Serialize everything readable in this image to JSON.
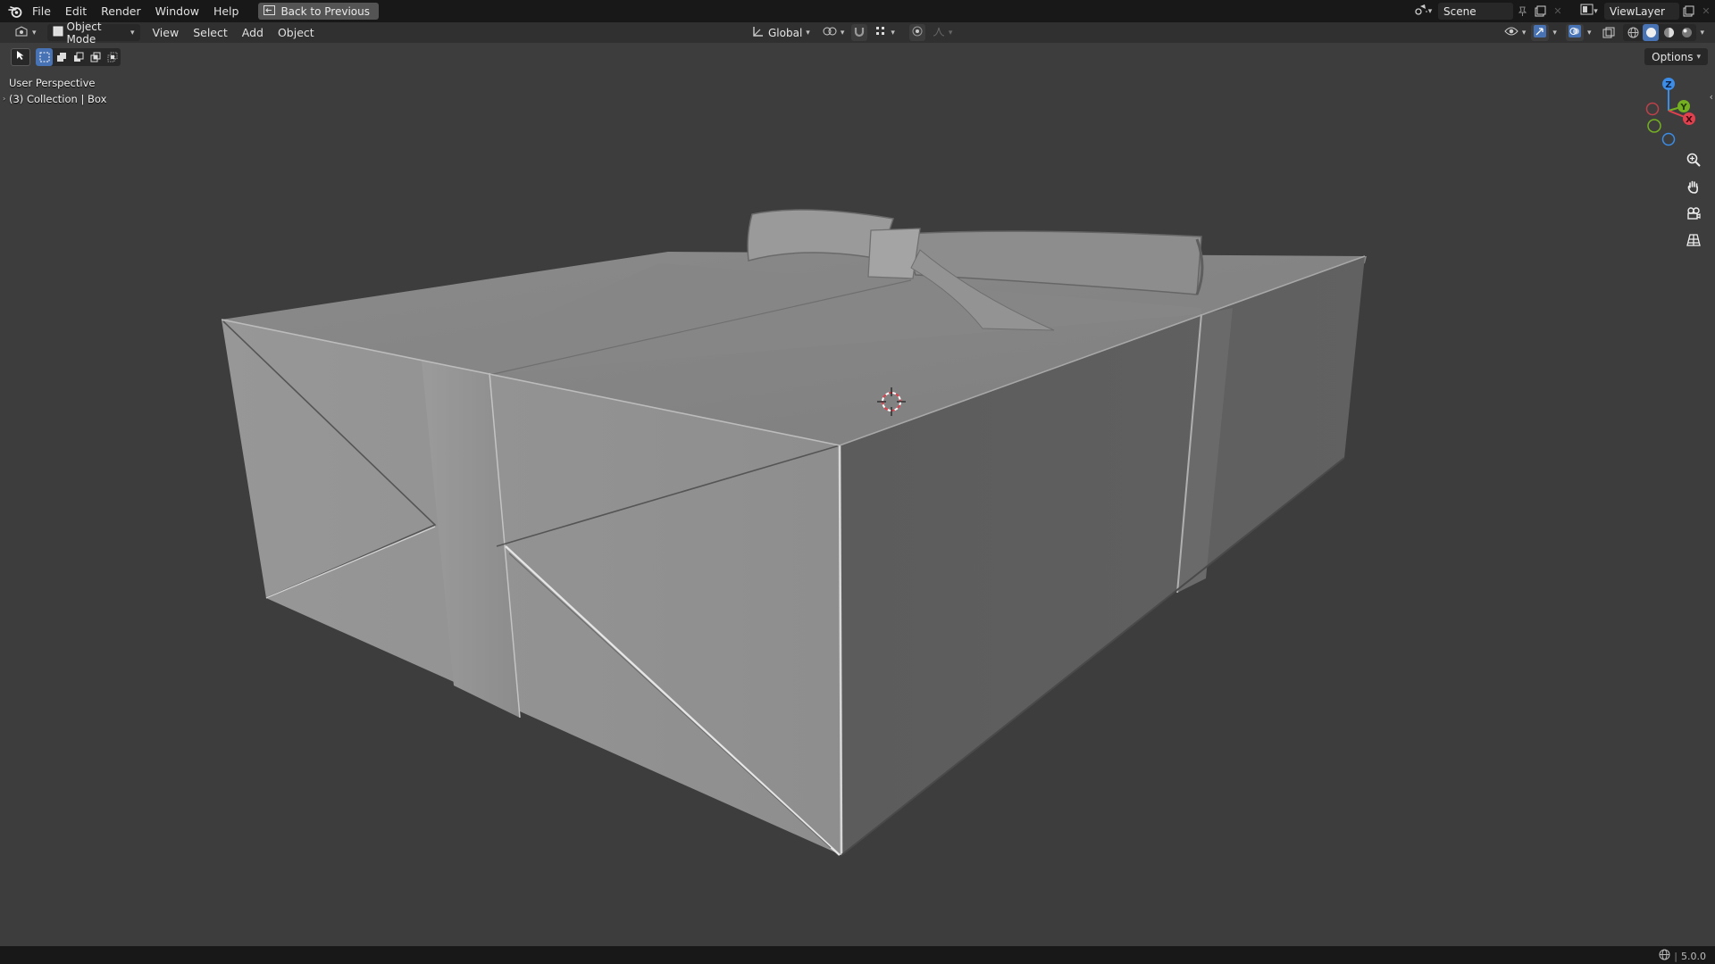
{
  "topbar": {
    "logo_icon": "blender-logo-icon",
    "menus": [
      "File",
      "Edit",
      "Render",
      "Window",
      "Help"
    ],
    "back_button": "Back to Previous",
    "scene_name": "Scene",
    "view_layer_name": "ViewLayer"
  },
  "header": {
    "editor_type_icon": "3d-viewport-icon",
    "mode": "Object Mode",
    "menus": [
      "View",
      "Select",
      "Add",
      "Object"
    ],
    "transform_orientation": "Global"
  },
  "viewport": {
    "view_name": "User Perspective",
    "collection_info": "(3) Collection | Box",
    "options_label": "Options",
    "gizmo_axes": {
      "x": "X",
      "y": "Y",
      "z": "Z"
    },
    "axis_colors": {
      "x": "#e0414e",
      "y": "#75b022",
      "z": "#3b8de8"
    }
  },
  "statusbar": {
    "version": "5.0.0"
  },
  "colors": {
    "accent": "#4772b3",
    "topbar_bg": "#181818",
    "header_bg": "#303030",
    "viewport_bg": "#3d3d3d"
  }
}
